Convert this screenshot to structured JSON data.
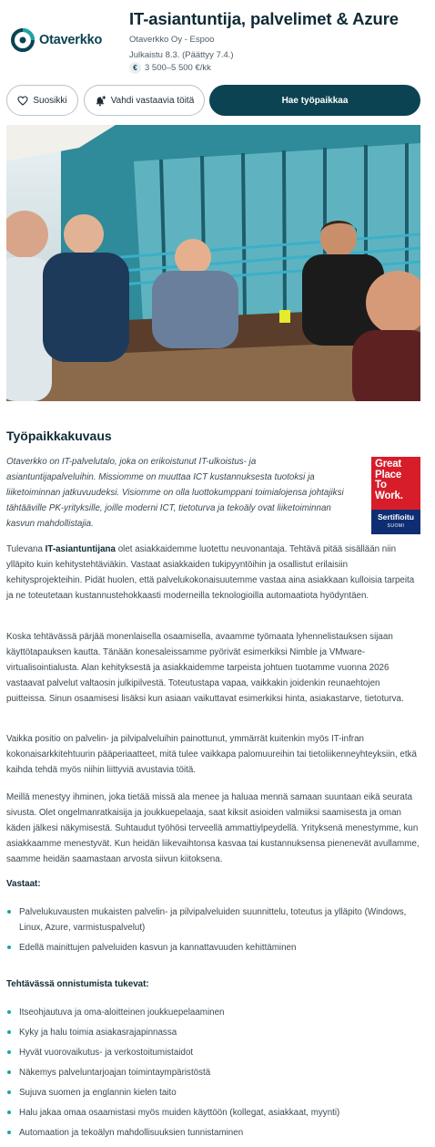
{
  "company_logo": {
    "name": "Otaverkko",
    "icon": "otaverkko-logo-icon"
  },
  "job": {
    "title": "IT-asiantuntija, palvelimet & Azure",
    "company_location": "Otaverkko Oy - Espoo",
    "published": "Julkaistu 8.3. (Päättyy 7.4.)",
    "salary_icon": "€",
    "salary": "3 500–5 500 €/kk"
  },
  "actions": {
    "favorite_label": "Suosikki",
    "favorite_icon": "heart-icon",
    "watch_label": "Vahdi vastaavia töitä",
    "watch_icon": "bell-plus-icon",
    "apply_label": "Hae työpaikkaa"
  },
  "description": {
    "title": "Työpaikkakuvaus",
    "intro": "Otaverkko on IT-palvelutalo, joka on erikoistunut IT-ulkoistus- ja asiantuntijapalveluihin. Missiomme on muuttaa ICT kustannuksesta tuotoksi ja liiketoiminnan jatkuvuudeksi. Visiomme on olla luottokumppani toimialojensa johtajiksi tähtääville PK-yrityksille, joille moderni ICT, tietoturva ja tekoäly ovat liiketoiminnan kasvun mahdollistajia.",
    "badge": {
      "line1": "Great",
      "line2": "Place",
      "line3": "To",
      "line4": "Work.",
      "certified": "Sertifioitu",
      "country": "SUOMI"
    },
    "p1_before": "Tulevana ",
    "p1_strong": "IT-asiantuntijana",
    "p1_after": " olet asiakkaidemme luotettu neuvonantaja. Tehtävä pitää sisällään niin ylläpito kuin kehitystehtäviäkin. Vastaat asiakkaiden tukipyyntöihin ja osallistut erilaisiin kehitysprojekteihin. Pidät huolen, että palvelukokonaisuutemme vastaa aina asiakkaan kulloisia tarpeita ja ne toteutetaan kustannustehokkaasti moderneilla teknologioilla automaatiota hyödyntäen.",
    "p2": "Koska tehtävässä pärjää monenlaisella osaamisella, avaamme työmaata lyhennelistauksen sijaan käyttötapauksen kautta. Tänään konesaleissamme pyörivät esimerkiksi Nimble ja VMware-virtualisointialusta. Alan kehityksestä ja asiakkaidemme tarpeista johtuen tuotamme vuonna 2026 vastaavat palvelut valtaosin julkipilvestä. Toteutustapa vapaa, vaikkakin joidenkin reunaehtojen puitteissa. Sinun osaamisesi lisäksi kun asiaan vaikuttavat esimerkiksi hinta, asiakastarve, tietoturva.",
    "p3": "Vaikka positio on palvelin- ja pilvipalveluihin painottunut, ymmärrät kuitenkin myös IT-infran kokonaisarkkitehtuurin pääperiaatteet, mitä tulee vaikkapa palomuureihin tai tietoliikenneyhteyksiin, etkä kaihda tehdä myös niihin liittyviä avustavia töitä.",
    "p4": "Meillä menestyy ihminen, joka tietää missä ala menee ja haluaa mennä samaan suuntaan eikä seurata sivusta. Olet ongelmanratkaisija ja joukkuepelaaja, saat kiksit asioiden valmiiksi saamisesta ja oman käden jälkesi näkymisestä. Suhtaudut työhösi terveellä ammattiylpeydellä. Yrityksenä menestymme, kun asiakkaamme menestyvät. Kun heidän liikevaihtonsa kasvaa tai kustannuksensa pienenevät avullamme, saamme heidän saamastaan arvosta siivun kiitoksena.",
    "responsibilities_title": "Vastaat:",
    "responsibilities": [
      "Palvelukuvausten mukaisten palvelin- ja pilvipalveluiden suunnittelu, toteutus ja ylläpito (Windows, Linux, Azure, varmistuspalvelut)",
      "Edellä mainittujen palveluiden kasvun ja kannattavuuden kehittäminen"
    ],
    "support_title": "Tehtävässä onnistumista tukevat:",
    "support": [
      "Itseohjautuva ja oma-aloitteinen joukkuepelaaminen",
      "Kyky ja halu toimia asiakasrajapinnassa",
      "Hyvät vuorovaikutus- ja verkostoitumistaidot",
      "Näkemys palveluntarjoajan toimintaympäristöstä",
      "Sujuva suomen ja englannin kielen taito",
      "Halu jakaa omaa osaamistasi myös muiden käyttöön (kollegat, asiakkaat, myynti)",
      "Automaation ja tekoälyn mahdollisuuksien tunnistaminen"
    ]
  }
}
